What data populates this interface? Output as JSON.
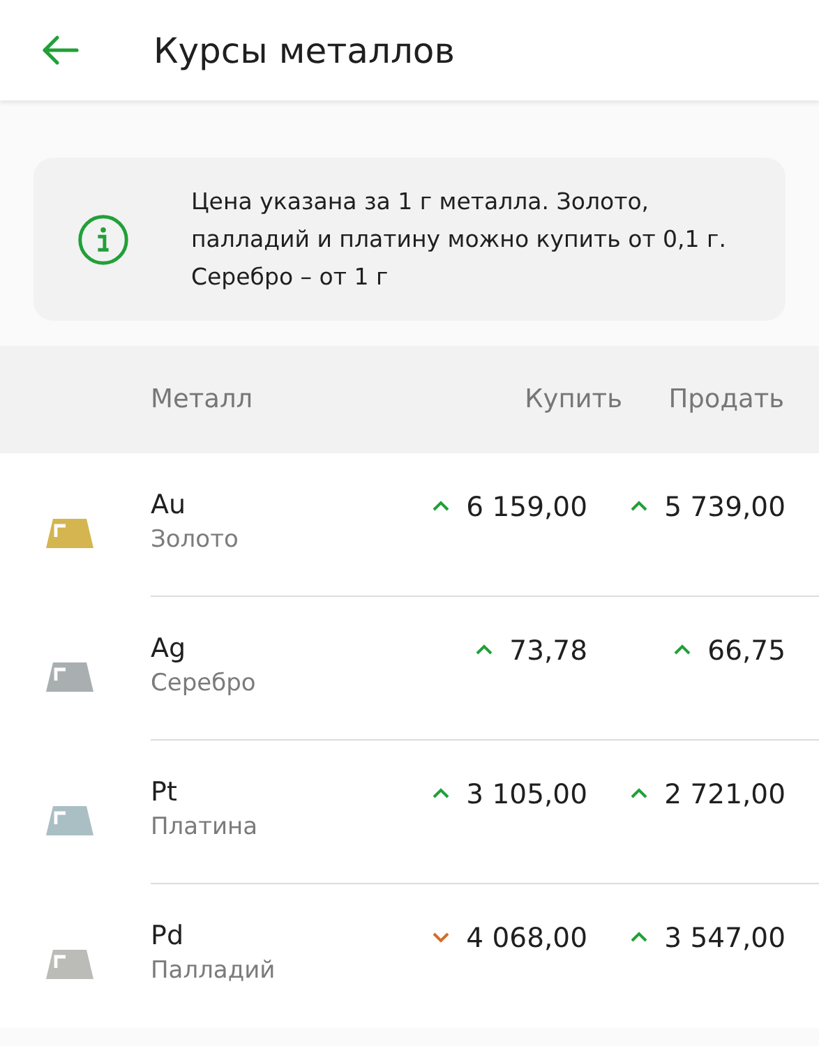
{
  "header": {
    "title": "Курсы металлов"
  },
  "info": {
    "text": "Цена указана за 1 г металла. Золото, палладий и платину можно купить от 0,1 г. Серебро – от 1 г"
  },
  "table": {
    "columns": [
      "Металл",
      "Купить",
      "Продать"
    ],
    "rows": [
      {
        "symbol": "Au",
        "name": "Золото",
        "color": "#d4b54f",
        "buy": {
          "value": "6 159,00",
          "rising": true
        },
        "sell": {
          "value": "5 739,00",
          "rising": true
        }
      },
      {
        "symbol": "Ag",
        "name": "Серебро",
        "color": "#a9afb0",
        "buy": {
          "value": "73,78",
          "rising": true
        },
        "sell": {
          "value": "66,75",
          "rising": true
        }
      },
      {
        "symbol": "Pt",
        "name": "Платина",
        "color": "#a9bfc4",
        "buy": {
          "value": "3 105,00",
          "rising": true
        },
        "sell": {
          "value": "2 721,00",
          "rising": true
        }
      },
      {
        "symbol": "Pd",
        "name": "Палладий",
        "color": "#bbbbb7",
        "buy": {
          "value": "4 068,00",
          "rising": false
        },
        "sell": {
          "value": "3 547,00",
          "rising": true
        }
      }
    ]
  }
}
